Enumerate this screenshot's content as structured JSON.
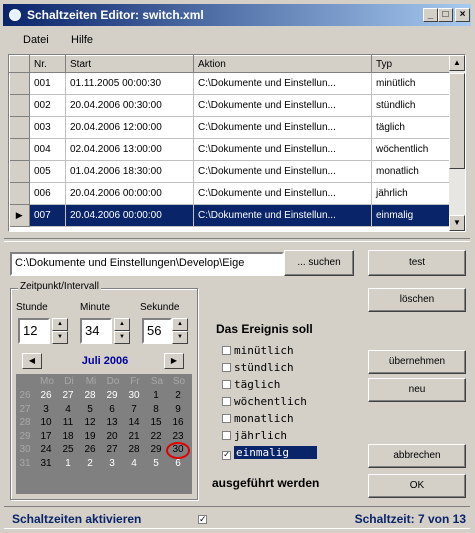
{
  "window": {
    "title": "Schaltzeiten Editor: switch.xml"
  },
  "titlebar_buttons": {
    "minimize": "_",
    "maximize": "□",
    "close": "×"
  },
  "menu": [
    "Datei",
    "Hilfe"
  ],
  "table": {
    "columns": [
      "Nr.",
      "Start",
      "Aktion",
      "Typ"
    ],
    "rows": [
      {
        "nr": "001",
        "start": "01.11.2005 00:00:30",
        "aktion": "C:\\Dokumente und Einstellun...",
        "typ": "minütlich"
      },
      {
        "nr": "002",
        "start": "20.04.2006 00:30:00",
        "aktion": "C:\\Dokumente und Einstellun...",
        "typ": "stündlich"
      },
      {
        "nr": "003",
        "start": "20.04.2006 12:00:00",
        "aktion": "C:\\Dokumente und Einstellun...",
        "typ": "täglich"
      },
      {
        "nr": "004",
        "start": "02.04.2006 13:00:00",
        "aktion": "C:\\Dokumente und Einstellun...",
        "typ": "wöchentlich"
      },
      {
        "nr": "005",
        "start": "01.04.2006 18:30:00",
        "aktion": "C:\\Dokumente und Einstellun...",
        "typ": "monatlich"
      },
      {
        "nr": "006",
        "start": "20.04.2006 00:00:00",
        "aktion": "C:\\Dokumente und Einstellun...",
        "typ": "jährlich"
      },
      {
        "nr": "007",
        "start": "20.04.2006 00:00:00",
        "aktion": "C:\\Dokumente und Einstellun...",
        "typ": "einmalig",
        "selected": true
      }
    ],
    "selected_indicator": "▶"
  },
  "path": {
    "value": "C:\\Dokumente und Einstellungen\\Develop\\Eige",
    "search_button": "... suchen",
    "test_button": "test"
  },
  "group": {
    "label": "Zeitpunkt/Intervall",
    "hour_label": "Stunde",
    "minute_label": "Minute",
    "second_label": "Sekunde",
    "hour": "12",
    "minute": "34",
    "second": "56"
  },
  "calendar": {
    "title": "Juli 2006",
    "weekdays": [
      "Mo",
      "Di",
      "Mi",
      "Do",
      "Fr",
      "Sa",
      "So"
    ],
    "weeks": [
      {
        "kw": "26",
        "days": [
          "26",
          "27",
          "28",
          "29",
          "30",
          "1",
          "2"
        ]
      },
      {
        "kw": "27",
        "days": [
          "3",
          "4",
          "5",
          "6",
          "7",
          "8",
          "9"
        ]
      },
      {
        "kw": "28",
        "days": [
          "10",
          "11",
          "12",
          "13",
          "14",
          "15",
          "16"
        ]
      },
      {
        "kw": "29",
        "days": [
          "17",
          "18",
          "19",
          "20",
          "21",
          "22",
          "23"
        ]
      },
      {
        "kw": "30",
        "days": [
          "24",
          "25",
          "26",
          "27",
          "28",
          "29",
          "30"
        ]
      },
      {
        "kw": "31",
        "days": [
          "31",
          "1",
          "2",
          "3",
          "4",
          "5",
          "6"
        ]
      }
    ],
    "today": "30"
  },
  "event": {
    "heading": "Das Ereignis soll",
    "options": [
      {
        "label": "minütlich",
        "checked": false
      },
      {
        "label": "stündlich",
        "checked": false
      },
      {
        "label": "täglich",
        "checked": false
      },
      {
        "label": "wöchentlich",
        "checked": false
      },
      {
        "label": "monatlich",
        "checked": false
      },
      {
        "label": "jährlich",
        "checked": false
      },
      {
        "label": "einmalig",
        "checked": true
      }
    ],
    "footer": "ausgeführt werden"
  },
  "buttons": {
    "loeschen": "löschen",
    "uebernehmen": "übernehmen",
    "neu": "neu",
    "abbrechen": "abbrechen",
    "ok": "OK"
  },
  "status": {
    "activate_label": "Schaltzeiten aktivieren",
    "activate_checked": true,
    "count": "Schaltzeit: 7 von 13"
  }
}
